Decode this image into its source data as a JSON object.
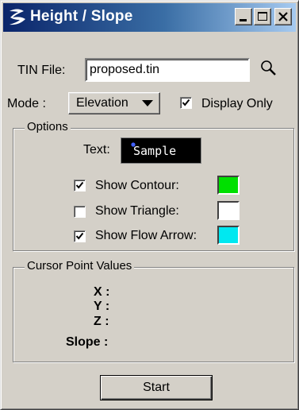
{
  "window": {
    "title": "Height / Slope",
    "title_gradient": [
      "#0a246a",
      "#a6caf0"
    ],
    "app_icon": "inroads-logo-icon",
    "controls": [
      "minimize-icon",
      "maximize-icon",
      "close-icon"
    ]
  },
  "tin": {
    "label": "TIN File:",
    "value": "proposed.tin",
    "browse_icon": "magnifier-icon"
  },
  "mode": {
    "label": "Mode :",
    "selected": "Elevation",
    "display_only_label": "Display Only",
    "display_only_checked": true
  },
  "options": {
    "legend": "Options",
    "text_label": "Text:",
    "sample_text": "Sample",
    "rows": [
      {
        "label": "Show Contour:",
        "checked": true,
        "color": "#00e000"
      },
      {
        "label": "Show Triangle:",
        "checked": false,
        "color": "#ffffff"
      },
      {
        "label": "Show Flow Arrow:",
        "checked": true,
        "color": "#00e8f0"
      }
    ]
  },
  "cursor": {
    "legend": "Cursor Point Values",
    "x_label": "X :",
    "y_label": "Y :",
    "z_label": "Z :",
    "slope_label": "Slope :"
  },
  "start_label": "Start"
}
